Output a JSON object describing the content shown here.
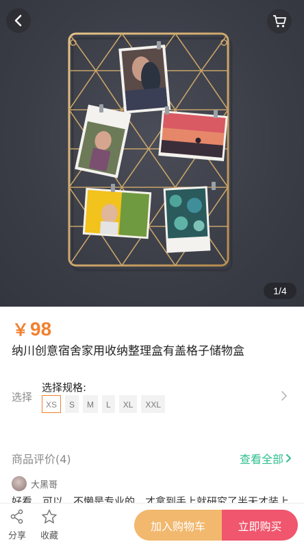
{
  "gallery": {
    "page_indicator": "1/4",
    "image_alt": "Gold wire grid memo board with clipped photos"
  },
  "product": {
    "price_currency": "￥",
    "price_value": "98",
    "title": "纳川创意宿舍家用收纳整理盒有盖格子储物盒"
  },
  "spec": {
    "label": "选择",
    "title": "选择规格:",
    "options": [
      "XS",
      "S",
      "M",
      "L",
      "XL",
      "XXL"
    ],
    "selected": "XS"
  },
  "reviews": {
    "title": "商品评价(4)",
    "view_all": "查看全部",
    "first": {
      "user": "大黑哥",
      "text": "好看，可以，不懒是专业的，才拿到手上就研究了半天才装上"
    }
  },
  "bottom_bar": {
    "share_label": "分享",
    "favorite_label": "收藏",
    "add_to_cart_label": "加入购物车",
    "buy_now_label": "立即购买"
  },
  "colors": {
    "price": "#f2802f",
    "view_all": "#2fbf8f",
    "add_to_cart": "#f1b86e",
    "buy_now": "#f0566d"
  },
  "icons": [
    "back-arrow-icon",
    "cart-icon",
    "share-icon",
    "star-icon",
    "chevron-right-icon"
  ]
}
